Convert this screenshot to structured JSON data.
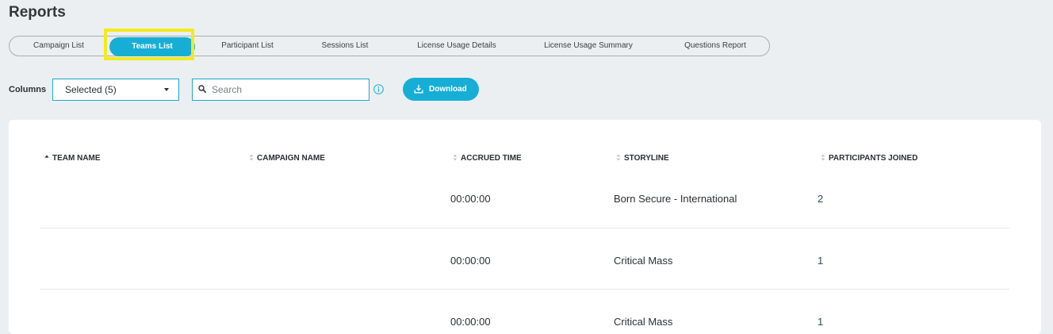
{
  "page": {
    "title": "Reports"
  },
  "tabs": [
    {
      "label": "Campaign List",
      "active": false
    },
    {
      "label": "Teams List",
      "active": true
    },
    {
      "label": "Participant List",
      "active": false
    },
    {
      "label": "Sessions List",
      "active": false
    },
    {
      "label": "License Usage Details",
      "active": false
    },
    {
      "label": "License Usage Summary",
      "active": false
    },
    {
      "label": "Questions Report",
      "active": false
    }
  ],
  "toolbar": {
    "columns_label": "Columns",
    "columns_value": "Selected (5)",
    "search_placeholder": "Search",
    "search_value": "",
    "download_label": "Download"
  },
  "table": {
    "headers": [
      "TEAM NAME",
      "CAMPAIGN NAME",
      "ACCRUED TIME",
      "STORYLINE",
      "PARTICIPANTS JOINED"
    ],
    "rows": [
      [
        "",
        "",
        "00:00:00",
        "Born Secure - International",
        "2"
      ],
      [
        "",
        "",
        "00:00:00",
        "Critical Mass",
        "1"
      ],
      [
        "",
        "",
        "00:00:00",
        "Critical Mass",
        "1"
      ]
    ]
  },
  "colors": {
    "accent": "#17aed6",
    "highlight": "#f3ea1c",
    "background": "#eceff2"
  },
  "icons": {
    "columns_select": "chevron-down-icon",
    "search": "search-icon",
    "info": "info-icon",
    "download": "download-icon",
    "sort_ascending": "sort-ascending-icon",
    "sort_neutral": "sort-icon"
  }
}
